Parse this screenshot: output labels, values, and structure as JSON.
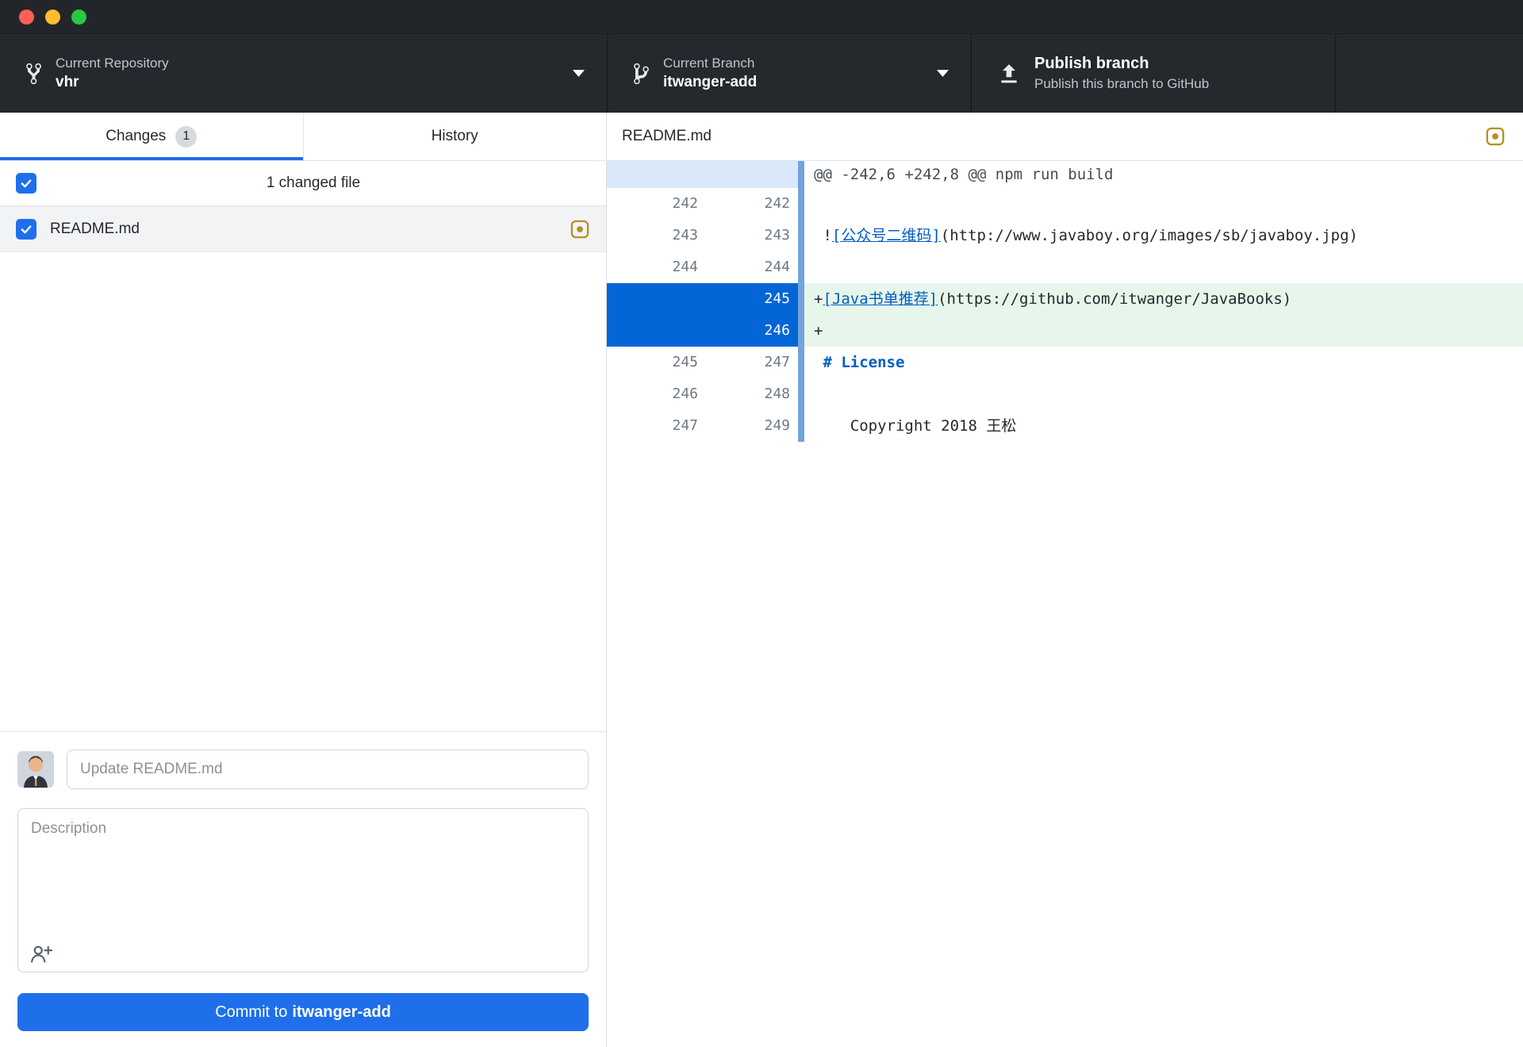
{
  "toolbar": {
    "repository": {
      "label": "Current Repository",
      "name": "vhr"
    },
    "branch": {
      "label": "Current Branch",
      "name": "itwanger-add"
    },
    "publish": {
      "title": "Publish branch",
      "subtitle": "Publish this branch to GitHub"
    }
  },
  "sidebar": {
    "tabs": {
      "changes": "Changes",
      "changes_badge": "1",
      "history": "History"
    },
    "summary_row": "1 changed file",
    "files": [
      {
        "name": "README.md",
        "status": "modified",
        "checked": true
      }
    ],
    "commit": {
      "summary_placeholder": "Update README.md",
      "description_placeholder": "Description",
      "button_prefix": "Commit to",
      "branch": "itwanger-add"
    }
  },
  "diff": {
    "title": "README.md",
    "status": "modified",
    "rows": [
      {
        "type": "hunk",
        "text": "@@ -242,6 +242,8 @@ npm run build"
      },
      {
        "type": "context",
        "old": "242",
        "new": "242",
        "segments": [
          {
            "text": " "
          }
        ]
      },
      {
        "type": "context",
        "old": "243",
        "new": "243",
        "segments": [
          {
            "text": " !"
          },
          {
            "text": "[公众号二维码]",
            "style": "link"
          },
          {
            "text": "(http://www.javaboy.org/images/sb/javaboy.jpg)"
          }
        ]
      },
      {
        "type": "context",
        "old": "244",
        "new": "244",
        "segments": [
          {
            "text": " "
          }
        ]
      },
      {
        "type": "added",
        "old": "",
        "new": "245",
        "selected": true,
        "segments": [
          {
            "text": "+"
          },
          {
            "text": "[Java书单推荐]",
            "style": "link"
          },
          {
            "text": "(https://github.com/itwanger/JavaBooks)"
          }
        ]
      },
      {
        "type": "added",
        "old": "",
        "new": "246",
        "selected": true,
        "segments": [
          {
            "text": "+"
          }
        ]
      },
      {
        "type": "context",
        "old": "245",
        "new": "247",
        "segments": [
          {
            "text": " "
          },
          {
            "text": "# License",
            "style": "heading"
          }
        ]
      },
      {
        "type": "context",
        "old": "246",
        "new": "248",
        "segments": [
          {
            "text": " "
          }
        ]
      },
      {
        "type": "context",
        "old": "247",
        "new": "249",
        "segments": [
          {
            "text": "    Copyright 2018 王松"
          }
        ]
      }
    ]
  },
  "colors": {
    "accent_blue": "#1f6feb",
    "selected_gutter_blue": "#0366d6",
    "added_line_green": "#e6f6ea",
    "link_blue": "#005cc5",
    "heading_blue": "#005cc5",
    "modified_icon_yellow": "#b79026",
    "toolbar_dark": "#24292e",
    "bar_blue": "#72a3dd",
    "traffic_red": "#ff5f57",
    "traffic_yellow": "#febc2e",
    "traffic_green": "#28c840"
  }
}
